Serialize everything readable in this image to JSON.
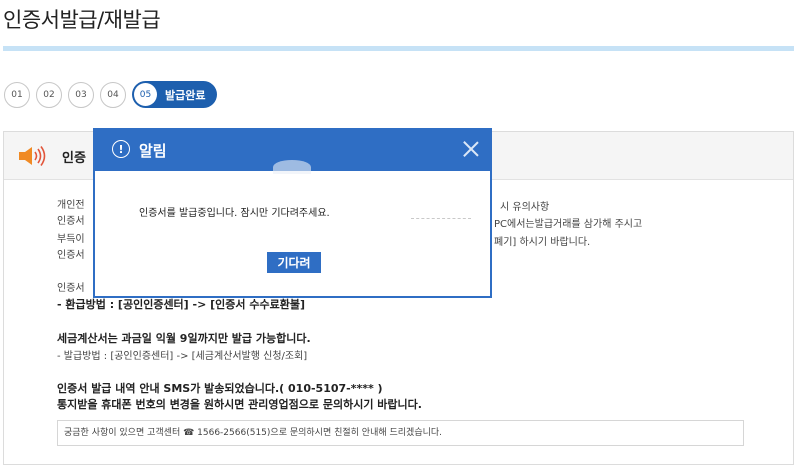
{
  "page": {
    "title": "인증서발급/재발급"
  },
  "steps": [
    {
      "num": "01"
    },
    {
      "num": "02"
    },
    {
      "num": "03"
    },
    {
      "num": "04"
    }
  ],
  "active_step": {
    "num": "05",
    "label": "발급완료"
  },
  "notice": {
    "header_title": "인증",
    "para1": [
      "개인전",
      "인증서",
      "부득이",
      "인증서"
    ],
    "para1_right": [
      "시 유의사항",
      "PC에서는발급거래를 삼가해 주시고",
      "폐기] 하시기 바랍니다."
    ],
    "para2_line1": "인증서",
    "refund_method": "- 환급방법 : [공인인증센터] -> [인증서 수수료환불]",
    "tax_bold": "세금계산서는 과금일 익월 9일까지만 발급 가능합니다.",
    "tax_method": "- 발급방법 : [공인인증센터] -> [세금계산서발행 신청/조회]",
    "sms_line": "인증서 발급 내역 안내 SMS가 발송되었습니다.( 010-5107-**** )",
    "phone_change": "통지받을 휴대폰 번호의 변경을 원하시면 관리영업점으로 문의하시기 바랍니다.",
    "contact": "궁금한 사항이 있으면 고객센터 ☎ 1566-2566(515)으로 문의하시면 친절히 안내해 드리겠습니다."
  },
  "modal": {
    "icon": "!",
    "title": "알림",
    "message": "인증서를 발급중입니다. 잠시만 기다려주세요.",
    "button_label": "기다려",
    "accent_color": "#2f6ec4"
  },
  "colors": {
    "step_active_bg": "#1d5fae",
    "title_bar": "#c6e2f6"
  }
}
